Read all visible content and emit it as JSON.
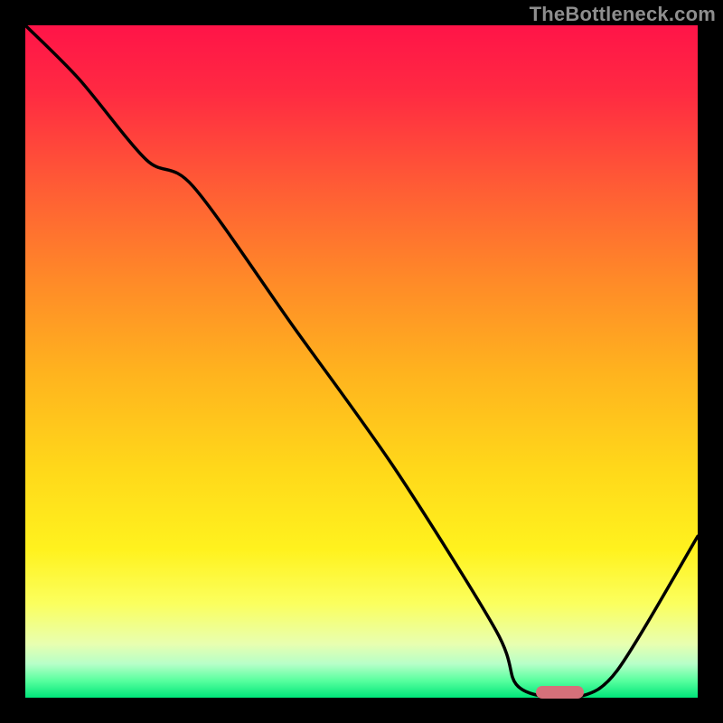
{
  "watermark": "TheBottleneck.com",
  "colors": {
    "bg": "#000000",
    "curve": "#000000",
    "marker": "#d6707a",
    "gradient_top": "#ff1448",
    "gradient_bottom": "#00e67a"
  },
  "chart_data": {
    "type": "line",
    "title": "",
    "xlabel": "",
    "ylabel": "",
    "xlim": [
      0,
      100
    ],
    "ylim": [
      0,
      100
    ],
    "grid": false,
    "legend": false,
    "x": [
      0,
      8,
      18,
      25,
      40,
      55,
      70,
      73,
      78,
      82,
      88,
      100
    ],
    "y": [
      100,
      92,
      80,
      76,
      55,
      34,
      10,
      2,
      0,
      0,
      4,
      24
    ],
    "marker_range_x": [
      76,
      83
    ],
    "annotations": []
  }
}
